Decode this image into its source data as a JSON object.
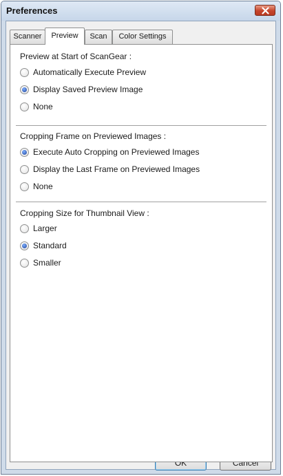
{
  "window": {
    "title": "Preferences"
  },
  "tabs": [
    {
      "label": "Scanner",
      "active": false
    },
    {
      "label": "Preview",
      "active": true
    },
    {
      "label": "Scan",
      "active": false
    },
    {
      "label": "Color Settings",
      "active": false
    }
  ],
  "groups": {
    "preview_start": {
      "title": "Preview at Start of ScanGear :",
      "options": [
        "Automatically Execute Preview",
        "Display Saved Preview Image",
        "None"
      ],
      "selected": "Display Saved Preview Image"
    },
    "cropping_frame": {
      "title": "Cropping Frame on Previewed Images :",
      "options": [
        "Execute Auto Cropping on Previewed Images",
        "Display the Last Frame on Previewed Images",
        "None"
      ],
      "selected": "Execute Auto Cropping on Previewed Images"
    },
    "thumbnail_size": {
      "title": "Cropping Size for Thumbnail View :",
      "options": [
        "Larger",
        "Standard",
        "Smaller"
      ],
      "selected": "Standard"
    }
  },
  "buttons": {
    "ok": "OK",
    "cancel": "Cancel"
  }
}
